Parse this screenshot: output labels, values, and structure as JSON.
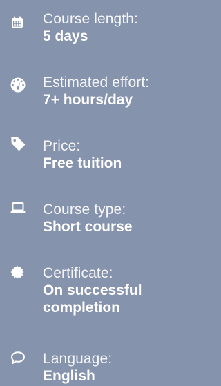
{
  "facts": [
    {
      "icon": "calendar-icon",
      "label": "Course length:",
      "value_lines": [
        "5 days"
      ]
    },
    {
      "icon": "speedometer-icon",
      "label": "Estimated effort:",
      "value_lines": [
        "7+ hours/day"
      ]
    },
    {
      "icon": "price-tag-icon",
      "label": "Price:",
      "value_lines": [
        "Free tuition"
      ]
    },
    {
      "icon": "laptop-icon",
      "label": "Course type:",
      "value_lines": [
        "Short course"
      ]
    },
    {
      "icon": "certificate-badge-icon",
      "label": "Certificate:",
      "value_lines": [
        "On successful",
        "completion"
      ]
    },
    {
      "icon": "speech-bubble-icon",
      "label": "Language:",
      "value_lines": [
        "English"
      ]
    }
  ],
  "colors": {
    "background": "#8693ac",
    "text": "#ffffff"
  }
}
